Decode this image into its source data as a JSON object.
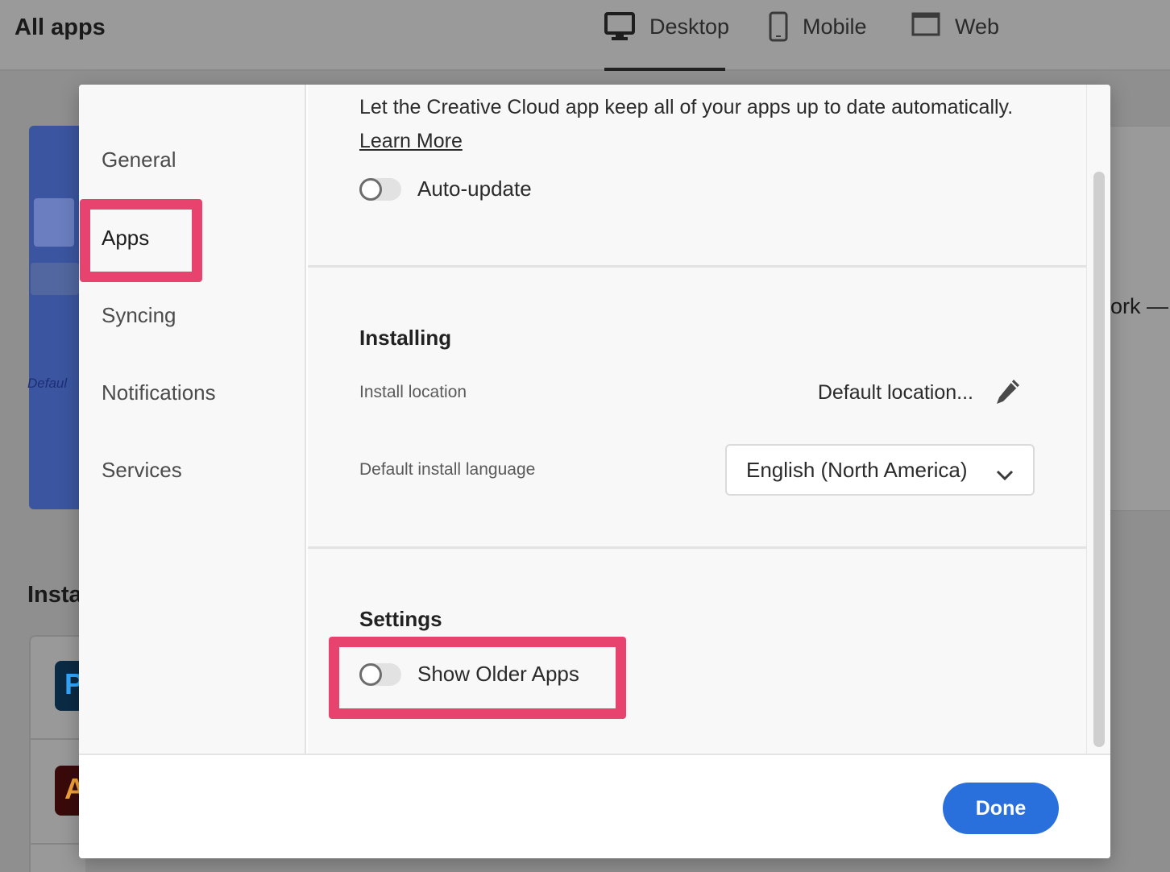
{
  "header": {
    "title": "All apps",
    "tabs": [
      {
        "label": "Desktop",
        "icon": "desktop-monitor-icon",
        "active": true
      },
      {
        "label": "Mobile",
        "icon": "mobile-phone-icon",
        "active": false
      },
      {
        "label": "Web",
        "icon": "browser-window-icon",
        "active": false
      }
    ]
  },
  "background": {
    "partial_heading": "Insta",
    "partial_text": "ork —",
    "banner_partial_text": "Defaul"
  },
  "dialog": {
    "sidebar": {
      "items": [
        {
          "label": "General",
          "active": false
        },
        {
          "label": "Apps",
          "active": true
        },
        {
          "label": "Syncing",
          "active": false
        },
        {
          "label": "Notifications",
          "active": false
        },
        {
          "label": "Services",
          "active": false
        }
      ]
    },
    "auto_update": {
      "description": "Let the Creative Cloud app keep all of your apps up to date automatically.",
      "learn_more": "Learn More",
      "toggle_label": "Auto-update",
      "enabled": false
    },
    "installing": {
      "title": "Installing",
      "install_location_label": "Install location",
      "install_location_value": "Default location...",
      "language_label": "Default install language",
      "language_value": "English (North America)"
    },
    "settings": {
      "title": "Settings",
      "show_older_apps_label": "Show Older Apps",
      "show_older_apps_enabled": false
    },
    "footer": {
      "done_label": "Done"
    }
  },
  "colors": {
    "highlight": "#e8436f",
    "primary_button": "#2a70dc",
    "overlay": "#8f8f8f"
  }
}
